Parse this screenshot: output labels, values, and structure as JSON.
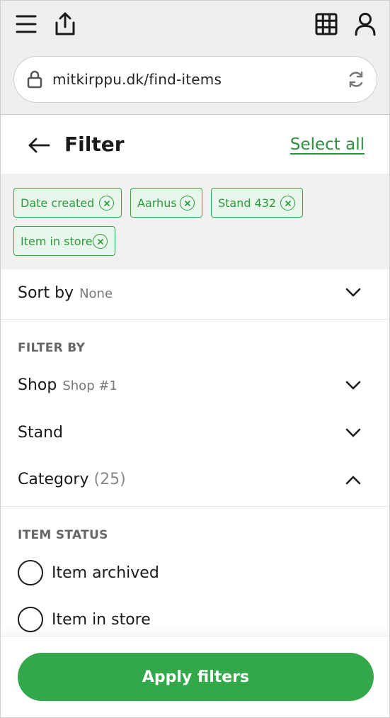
{
  "browser": {
    "url": "mitkirppu.dk/find-items",
    "icons": [
      "menu-icon",
      "share-icon",
      "grid-icon",
      "user-icon",
      "lock-icon",
      "reload-icon"
    ]
  },
  "header": {
    "title": "Filter",
    "select_all": "Select all"
  },
  "chips": [
    {
      "label": "Date created"
    },
    {
      "label": "Aarhus"
    },
    {
      "label": "Stand 432"
    },
    {
      "label": "Item in store"
    }
  ],
  "sort": {
    "label": "Sort by",
    "value": "None"
  },
  "filter_by": {
    "title": "FILTER BY",
    "shop": {
      "label": "Shop",
      "value": "Shop #1"
    },
    "stand": {
      "label": "Stand"
    },
    "category": {
      "label": "Category",
      "count": "(25)"
    }
  },
  "item_status": {
    "title": "ITEM STATUS",
    "options": [
      {
        "label": "Item archived"
      },
      {
        "label": "Item in store"
      }
    ]
  },
  "apply_label": "Apply filters",
  "colors": {
    "accent": "#33a84a",
    "chip_bg": "#e9f6eb",
    "link": "#2f8f3f"
  }
}
